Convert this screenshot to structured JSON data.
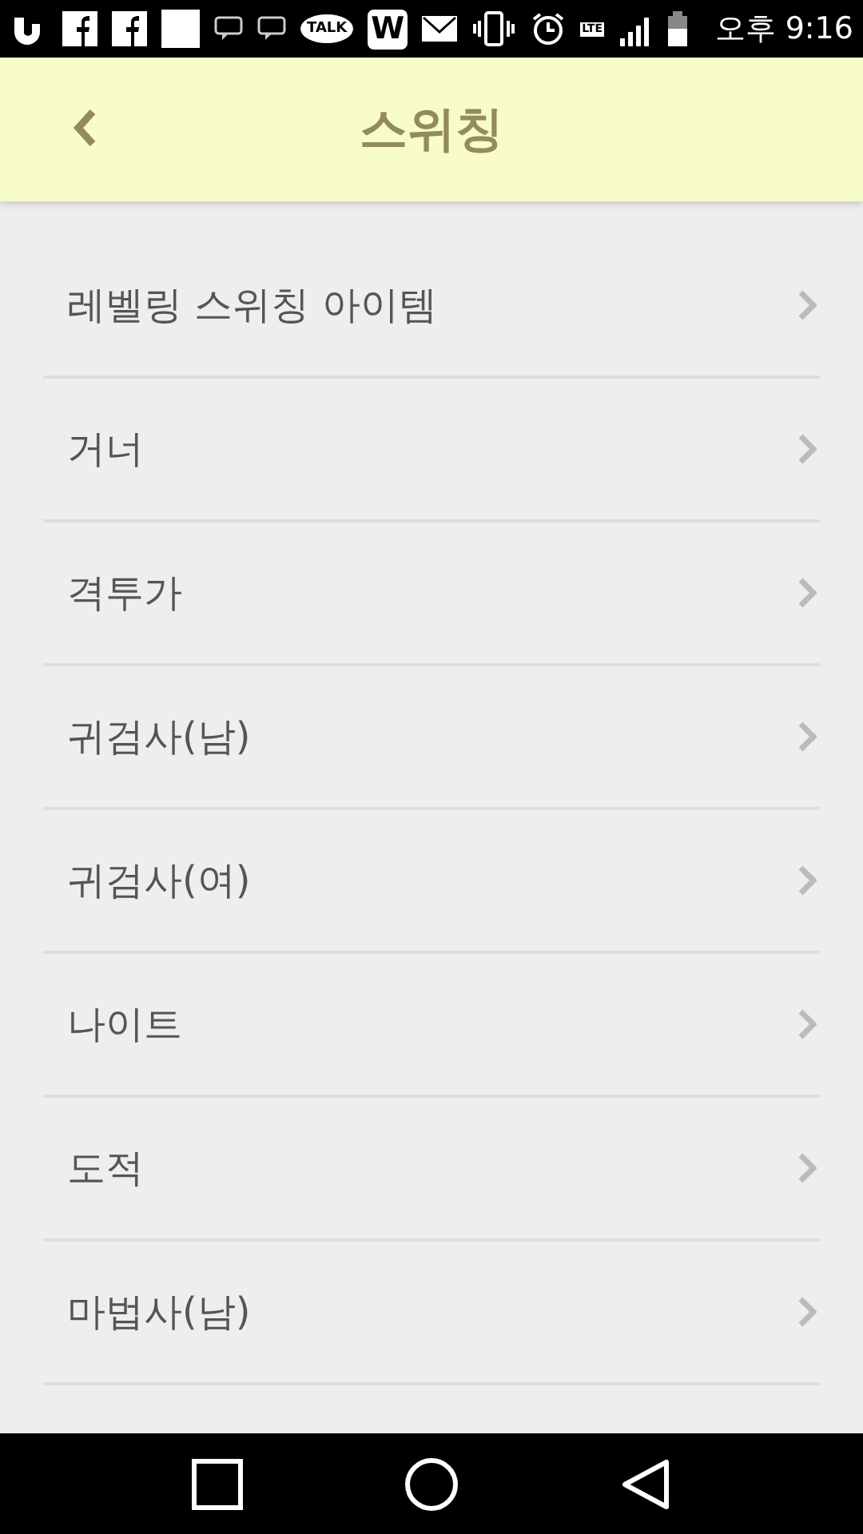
{
  "status_bar": {
    "icons": [
      {
        "kind": "u"
      },
      {
        "kind": "fb"
      },
      {
        "kind": "fb"
      },
      {
        "kind": "note"
      },
      {
        "kind": "chat"
      },
      {
        "kind": "chat"
      },
      {
        "kind": "talk",
        "label": "TALK"
      },
      {
        "kind": "w",
        "label": "W"
      },
      {
        "kind": "mail"
      },
      {
        "kind": "vibrate"
      },
      {
        "kind": "alarm"
      },
      {
        "kind": "lte",
        "label": "LTE"
      },
      {
        "kind": "signal"
      },
      {
        "kind": "battery"
      }
    ],
    "time": "오후 9:16"
  },
  "header": {
    "title": "스위칭"
  },
  "items": [
    {
      "label": "레벨링 스위칭 아이템"
    },
    {
      "label": "거너"
    },
    {
      "label": "격투가"
    },
    {
      "label": "귀검사(남)"
    },
    {
      "label": "귀검사(여)"
    },
    {
      "label": "나이트"
    },
    {
      "label": "도적"
    },
    {
      "label": "마법사(남)"
    }
  ]
}
